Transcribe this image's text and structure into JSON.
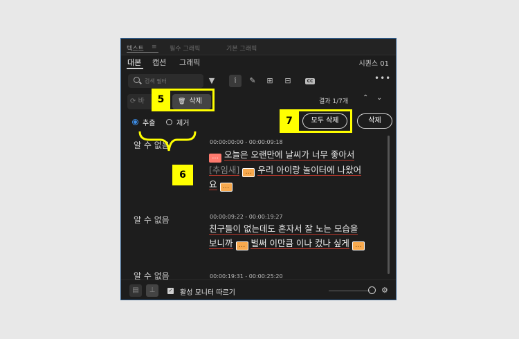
{
  "panel": {
    "top_tabs": [
      "텍스트",
      "필수 그래픽",
      "기본 그래픽"
    ],
    "top_tab_extra": "≡",
    "sub_tabs": [
      "대본",
      "캡션",
      "그래픽"
    ],
    "sequence": "시퀀스 01"
  },
  "toolbar": {
    "search_placeholder": "검색 필터",
    "cc_label": "CC",
    "more_label": "•••"
  },
  "actions": {
    "bg_button_label": "바",
    "delete_label": "삭제",
    "results": "결과 1/7개",
    "prev_icon": "chevron-up-icon",
    "next_icon": "chevron-down-icon"
  },
  "options": {
    "extract_label": "추출",
    "remove_label": "제거",
    "delete_all_label": "모두 삭제",
    "delete_label": "삭제"
  },
  "segments": [
    {
      "speaker": "알 수 없음",
      "timecode": "00:00:00:00 - 00:00:09:18",
      "pause": "...",
      "line1": "오늘은 오랜만에 날씨가 너무 좋아서",
      "sound": "[추임새]",
      "line2": "우리 아이랑 놀이터에 나왔어",
      "line3": "요"
    },
    {
      "speaker": "알 수 없음",
      "timecode": "00:00:09:22 - 00:00:19:27",
      "pause": "...",
      "line1": "친구들이 없는데도 혼자서 잘 노는 모습을",
      "line2a": "보니까",
      "line2b": "벌써 이만큼 이나 컸나 싶게"
    },
    {
      "speaker": "알 수 없음",
      "timecode": "00:00:19:31 - 00:00:25:20"
    }
  ],
  "footer": {
    "follow_monitor_label": "활성 모니터 따르기",
    "follow_checked": true
  },
  "annotations": {
    "label5": "5",
    "label6": "6",
    "label7": "7"
  },
  "colors": {
    "accent_blue": "#3d8ee8",
    "highlight_yellow": "#ffff00",
    "pause_red": "#ff7a6e",
    "pause_orange": "#f7a94e"
  }
}
